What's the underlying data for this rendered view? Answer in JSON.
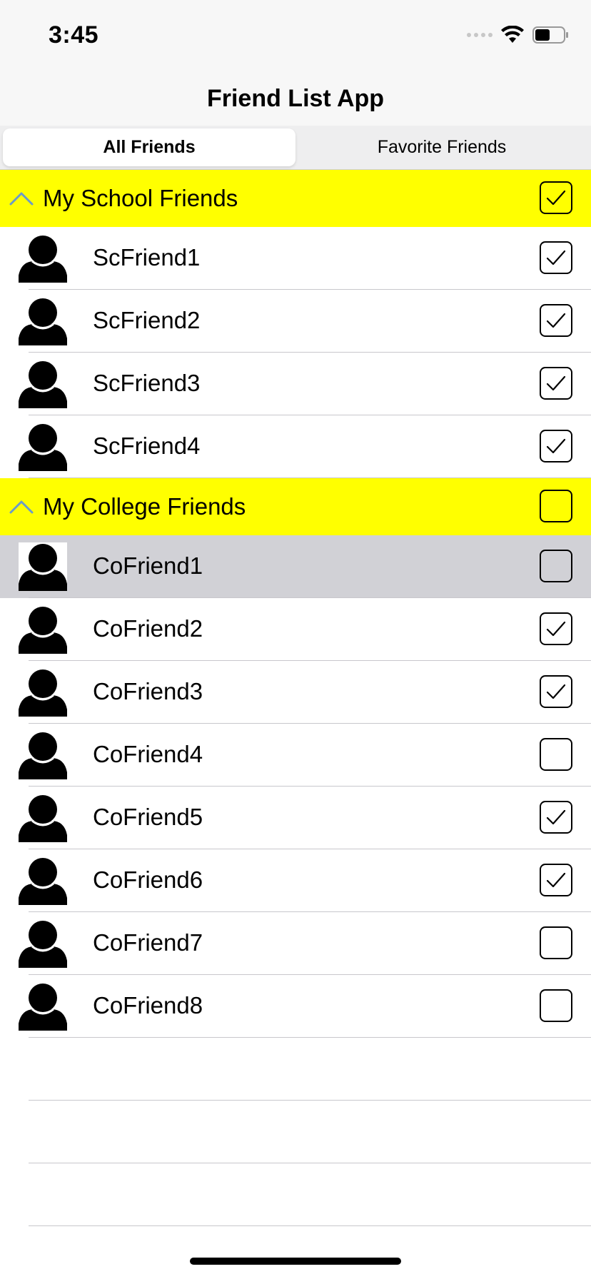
{
  "status_bar": {
    "time": "3:45"
  },
  "nav": {
    "title": "Friend List App"
  },
  "tabs": [
    {
      "label": "All Friends",
      "active": true
    },
    {
      "label": "Favorite Friends",
      "active": false
    }
  ],
  "sections": [
    {
      "title": "My School Friends",
      "checked": true,
      "friends": [
        {
          "name": "ScFriend1",
          "checked": true
        },
        {
          "name": "ScFriend2",
          "checked": true
        },
        {
          "name": "ScFriend3",
          "checked": true
        },
        {
          "name": "ScFriend4",
          "checked": true
        }
      ]
    },
    {
      "title": "My College Friends",
      "checked": false,
      "friends": [
        {
          "name": "CoFriend1",
          "checked": false,
          "selected": true
        },
        {
          "name": "CoFriend2",
          "checked": true
        },
        {
          "name": "CoFriend3",
          "checked": true
        },
        {
          "name": "CoFriend4",
          "checked": false
        },
        {
          "name": "CoFriend5",
          "checked": true
        },
        {
          "name": "CoFriend6",
          "checked": true
        },
        {
          "name": "CoFriend7",
          "checked": false
        },
        {
          "name": "CoFriend8",
          "checked": false
        }
      ]
    }
  ],
  "colors": {
    "section_header_bg": "#ffff00",
    "chevron": "#6b9bc8",
    "selected_row_bg": "#d1d1d6"
  }
}
